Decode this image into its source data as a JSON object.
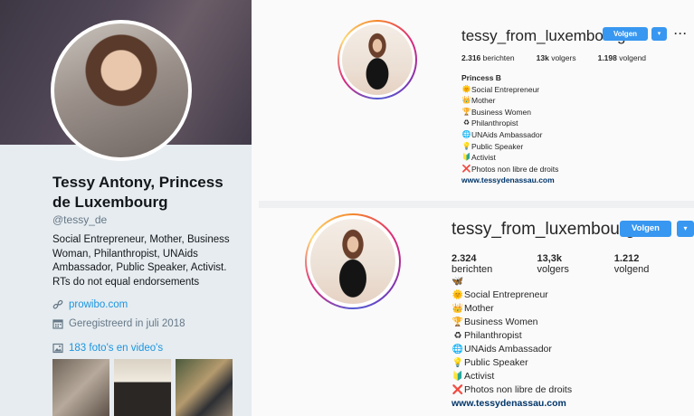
{
  "twitter": {
    "name": "Tessy Antony, Princess de Luxembourg",
    "handle": "@tessy_de",
    "bio": "Social Entrepreneur, Mother, Business Woman, Philanthropist, UNAids Ambassador, Public Speaker, Activist. RTs do not equal endorsements",
    "website": "prowibo.com",
    "joined": "Geregistreerd in juli 2018",
    "media_label": "183 foto's en video's",
    "icons": {
      "link": "link-icon",
      "calendar": "calendar-icon",
      "media": "image-icon"
    }
  },
  "instagram_top": {
    "username": "tessy_from_luxembourg",
    "follow_label": "Volgen",
    "dropdown_glyph": "▾",
    "more_glyph": "···",
    "stats": [
      {
        "count": "2.316",
        "label": "berichten"
      },
      {
        "count": "13k",
        "label": "volgers"
      },
      {
        "count": "1.198",
        "label": "volgend"
      }
    ],
    "bio_title": "Princess B",
    "bio_lines": [
      {
        "emoji": "🌞",
        "text": "Social Entrepreneur"
      },
      {
        "emoji": "👑",
        "text": "Mother"
      },
      {
        "emoji": "🏆",
        "text": "Business Women"
      },
      {
        "emoji": "♻",
        "text": "Philanthropist"
      },
      {
        "emoji": "🌐",
        "text": "UNAids Ambassador"
      },
      {
        "emoji": "💡",
        "text": "Public Speaker"
      },
      {
        "emoji": "🔰",
        "text": "Activist"
      },
      {
        "emoji": "❌",
        "text": "Photos non libre de droits"
      }
    ],
    "website": "www.tessydenassau.com"
  },
  "instagram_bottom": {
    "username": "tessy_from_luxembourg",
    "follow_label": "Volgen",
    "dropdown_glyph": "▾",
    "stats": [
      {
        "count": "2.324",
        "label": "berichten"
      },
      {
        "count": "13,3k",
        "label": "volgers"
      },
      {
        "count": "1.212",
        "label": "volgend"
      }
    ],
    "bio_title": "🦋",
    "bio_lines": [
      {
        "emoji": "🌞",
        "text": "Social Entrepreneur"
      },
      {
        "emoji": "👑",
        "text": "Mother"
      },
      {
        "emoji": "🏆",
        "text": "Business Women"
      },
      {
        "emoji": "♻",
        "text": "Philanthropist"
      },
      {
        "emoji": "🌐",
        "text": "UNAids Ambassador"
      },
      {
        "emoji": "💡",
        "text": "Public Speaker"
      },
      {
        "emoji": "🔰",
        "text": "Activist"
      },
      {
        "emoji": "❌",
        "text": "Photos non libre de droits"
      }
    ],
    "website": "www.tessydenassau.com"
  },
  "colors": {
    "twitter_link": "#1b95e0",
    "instagram_button": "#3897f0",
    "twitter_bg": "#e6ecf0"
  }
}
